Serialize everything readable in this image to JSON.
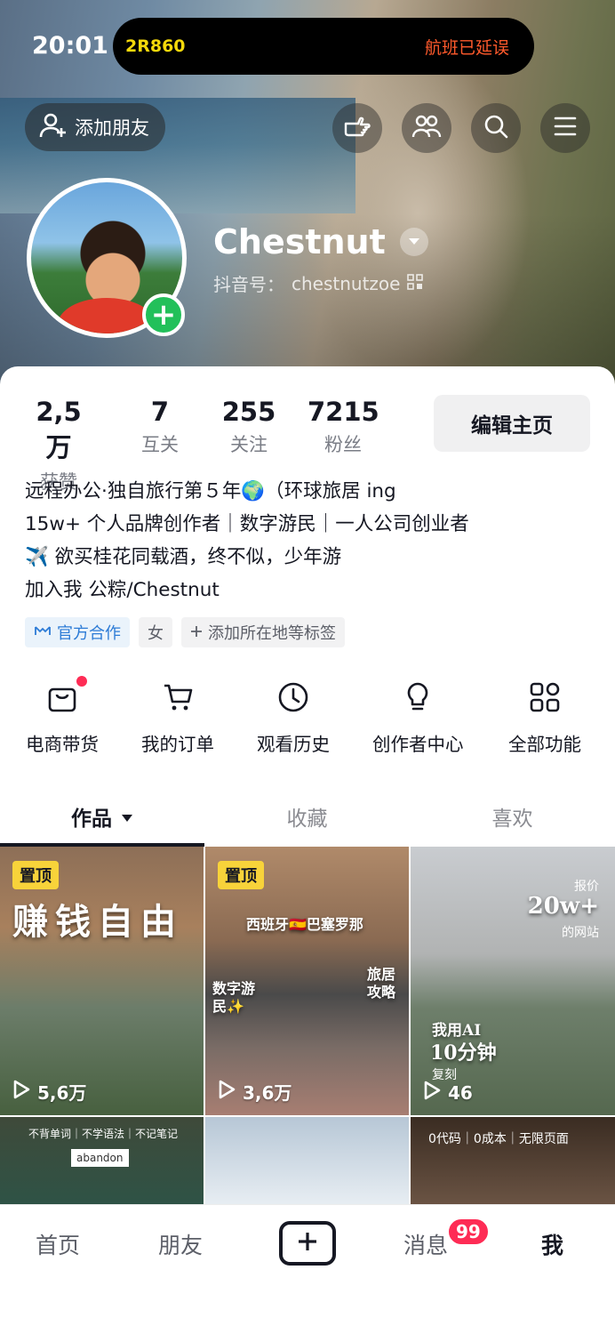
{
  "status_bar": {
    "time": "20:01"
  },
  "live_activity": {
    "flight": "2R860",
    "status": "航班已延误"
  },
  "header": {
    "add_friend": "添加朋友",
    "icons": [
      "hand-pointer-icon",
      "friends-icon",
      "search-icon",
      "menu-icon"
    ]
  },
  "profile": {
    "username": "Chestnut",
    "douyin_id_label": "抖音号：",
    "douyin_id": "chestnutzoe"
  },
  "stats": [
    {
      "value": "2,5万",
      "label": "获赞"
    },
    {
      "value": "7",
      "label": "互关"
    },
    {
      "value": "255",
      "label": "关注"
    },
    {
      "value": "7215",
      "label": "粉丝"
    }
  ],
  "edit_button": "编辑主页",
  "bio": [
    "远程办公·独自旅行第５年🌍（环球旅居 ing",
    "15w+ 个人品牌创作者｜数字游民｜一人公司创业者",
    "✈️ 欲买桂花同载酒，终不似，少年游",
    "加入我 公粽/Chestnut"
  ],
  "tags": [
    "官方合作",
    "女",
    "添加所在地等标签"
  ],
  "features": [
    {
      "label": "电商带货",
      "icon": "shopping-bag-icon",
      "dot": true
    },
    {
      "label": "我的订单",
      "icon": "cart-icon",
      "dot": false
    },
    {
      "label": "观看历史",
      "icon": "clock-icon",
      "dot": false
    },
    {
      "label": "创作者中心",
      "icon": "lightbulb-icon",
      "dot": false
    },
    {
      "label": "全部功能",
      "icon": "grid-apps-icon",
      "dot": false
    }
  ],
  "tabs": [
    "作品",
    "收藏",
    "喜欢"
  ],
  "videos": [
    {
      "pinned": "置顶",
      "views": "5,6万",
      "title": "赚钱自由"
    },
    {
      "pinned": "置顶",
      "views": "3,6万",
      "title": "西班牙🇪🇸巴塞罗那",
      "sub1": "数字游民✨",
      "sub2": "旅居攻略"
    },
    {
      "views": "46",
      "caption1": "报价",
      "caption2": "20w+",
      "caption3": "的网站",
      "caption4": "我用AI",
      "caption5": "10分钟",
      "caption6": "复刻"
    },
    {
      "caption": "不背单词｜不学语法｜不记笔记",
      "caption_b": "abandon"
    },
    {},
    {
      "caption": "0代码｜0成本｜无限页面"
    }
  ],
  "bottom_nav": {
    "home": "首页",
    "friends": "朋友",
    "messages": "消息",
    "me": "我",
    "badge": "99"
  }
}
